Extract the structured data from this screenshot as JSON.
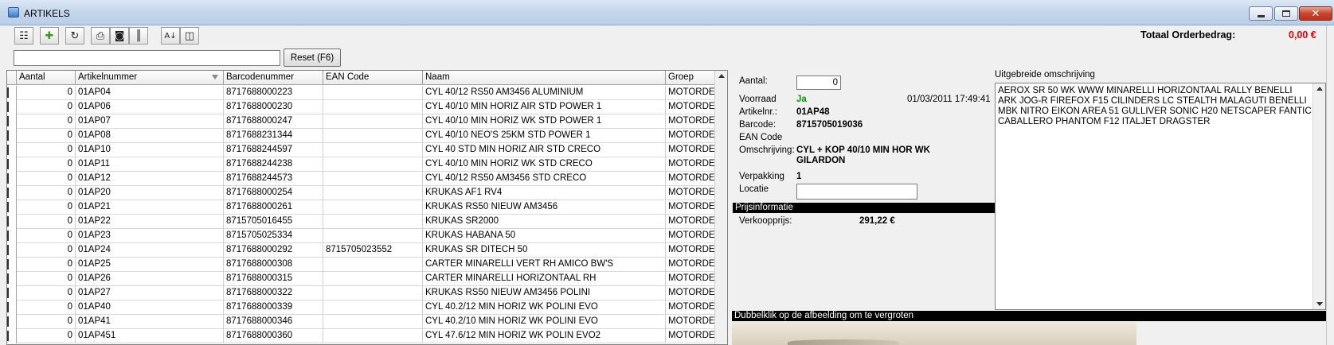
{
  "window": {
    "title": "ARTIKELS"
  },
  "toolbar": {
    "buttons": [
      "properties-icon",
      "favorite-star-icon",
      "refresh-icon",
      "print-icon",
      "camera-icon",
      "barcode-icon",
      "sort-az-icon",
      "columns-icon"
    ],
    "total_label": "Totaal Orderbedrag:",
    "total_value": "0,00 €",
    "total_color": "#e00000"
  },
  "search": {
    "value": "",
    "reset_label": "Reset (F6)"
  },
  "grid": {
    "columns": [
      "Aantal",
      "Artikelnummer",
      "Barcodenummer",
      "EAN Code",
      "Naam",
      "Groep"
    ],
    "rows": [
      [
        "0",
        "01AP04",
        "8717688000223",
        "",
        "CYL 40/12 RS50 AM3456 ALUMINIUM",
        "MOTORDELE"
      ],
      [
        "0",
        "01AP06",
        "8717688000230",
        "",
        "CYL 40/10 MIN HORIZ AIR STD POWER 1",
        "MOTORDELE"
      ],
      [
        "0",
        "01AP07",
        "8717688000247",
        "",
        "CYL 40/10 MIN HORIZ WK STD POWER 1",
        "MOTORDELE"
      ],
      [
        "0",
        "01AP08",
        "8717688231344",
        "",
        "CYL 40/10 NEO'S 25KM STD POWER 1",
        "MOTORDELE"
      ],
      [
        "0",
        "01AP10",
        "8717688244597",
        "",
        "CYL 40 STD MIN HORIZ AIR STD CRECO",
        "MOTORDELE"
      ],
      [
        "0",
        "01AP11",
        "8717688244238",
        "",
        "CYL 40/10 MIN HORIZ WK STD CRECO",
        "MOTORDELE"
      ],
      [
        "0",
        "01AP12",
        "8717688244573",
        "",
        "CYL 40/12 RS50 AM3456 STD CRECO",
        "MOTORDELE"
      ],
      [
        "0",
        "01AP20",
        "8717688000254",
        "",
        "KRUKAS AF1 RV4",
        "MOTORDELE"
      ],
      [
        "0",
        "01AP21",
        "8717688000261",
        "",
        "KRUKAS RS50 NIEUW AM3456",
        "MOTORDELE"
      ],
      [
        "0",
        "01AP22",
        "8715705016455",
        "",
        "KRUKAS SR2000",
        "MOTORDELE"
      ],
      [
        "0",
        "01AP23",
        "8715705025334",
        "",
        "KRUKAS HABANA 50",
        "MOTORDELE"
      ],
      [
        "0",
        "01AP24",
        "8717688000292",
        "8715705023552",
        "KRUKAS SR DITECH 50",
        "MOTORDELE"
      ],
      [
        "0",
        "01AP25",
        "8717688000308",
        "",
        "CARTER MINARELLI VERT RH AMICO BW'S",
        "MOTORDELE"
      ],
      [
        "0",
        "01AP26",
        "8717688000315",
        "",
        "CARTER MINARELLI HORIZONTAAL RH",
        "MOTORDELE"
      ],
      [
        "0",
        "01AP27",
        "8717688000322",
        "",
        "KRUKAS RS50 NIEUW AM3456 POLINI",
        "MOTORDELE"
      ],
      [
        "0",
        "01AP40",
        "8717688000339",
        "",
        "CYL 40.2/12 MIN HORIZ WK POLINI EVO",
        "MOTORDELE"
      ],
      [
        "0",
        "01AP41",
        "8717688000346",
        "",
        "CYL 40.2/10 MIN HORIZ WK POLINI EVO",
        "MOTORDELE"
      ],
      [
        "0",
        "01AP451",
        "8717688000360",
        "",
        "CYL 47.6/12 MIN HORIZ WK POLIN EVO2",
        "MOTORDELE"
      ]
    ]
  },
  "detail": {
    "aantal_label": "Aantal:",
    "aantal_value": "0",
    "voorraad_label": "Voorraad",
    "voorraad_value": "Ja",
    "voorraad_color": "#00a000",
    "timestamp": "01/03/2011 17:49:41",
    "artikelnr_label": "Artikelnr.:",
    "artikelnr_value": "01AP48",
    "barcode_label": "Barcode:",
    "barcode_value": "8715705019036",
    "ean_label": "EAN Code",
    "omschrijving_label": "Omschrijving:",
    "omschrijving_line1": "CYL + KOP 40/10 MIN HOR WK",
    "omschrijving_line2": "GILARDON",
    "verpakking_label": "Verpakking",
    "verpakking_value": "1",
    "locatie_label": "Locatie",
    "locatie_value": "",
    "prijs_header": "Prijsinformatie",
    "verkoopprijs_label": "Verkoopprijs:",
    "verkoopprijs_value": "291,22 €",
    "image_hint": "Dubbelklik op de afbeelding om te vergroten"
  },
  "description": {
    "label": "Uitgebreide omschrijving",
    "text": "AEROX SR 50 WK WWW MINARELLI HORIZONTAAL  RALLY  BENELLI ARK JOG-R  FIREFOX F15 CILINDERS LC STEALTH MALAGUTI BENELLI MBK NITRO EIKON AREA 51 GULLIVER SONIC H20 NETSCAPER FANTIC CABALLERO PHANTOM F12 ITALJET DRAGSTER"
  }
}
